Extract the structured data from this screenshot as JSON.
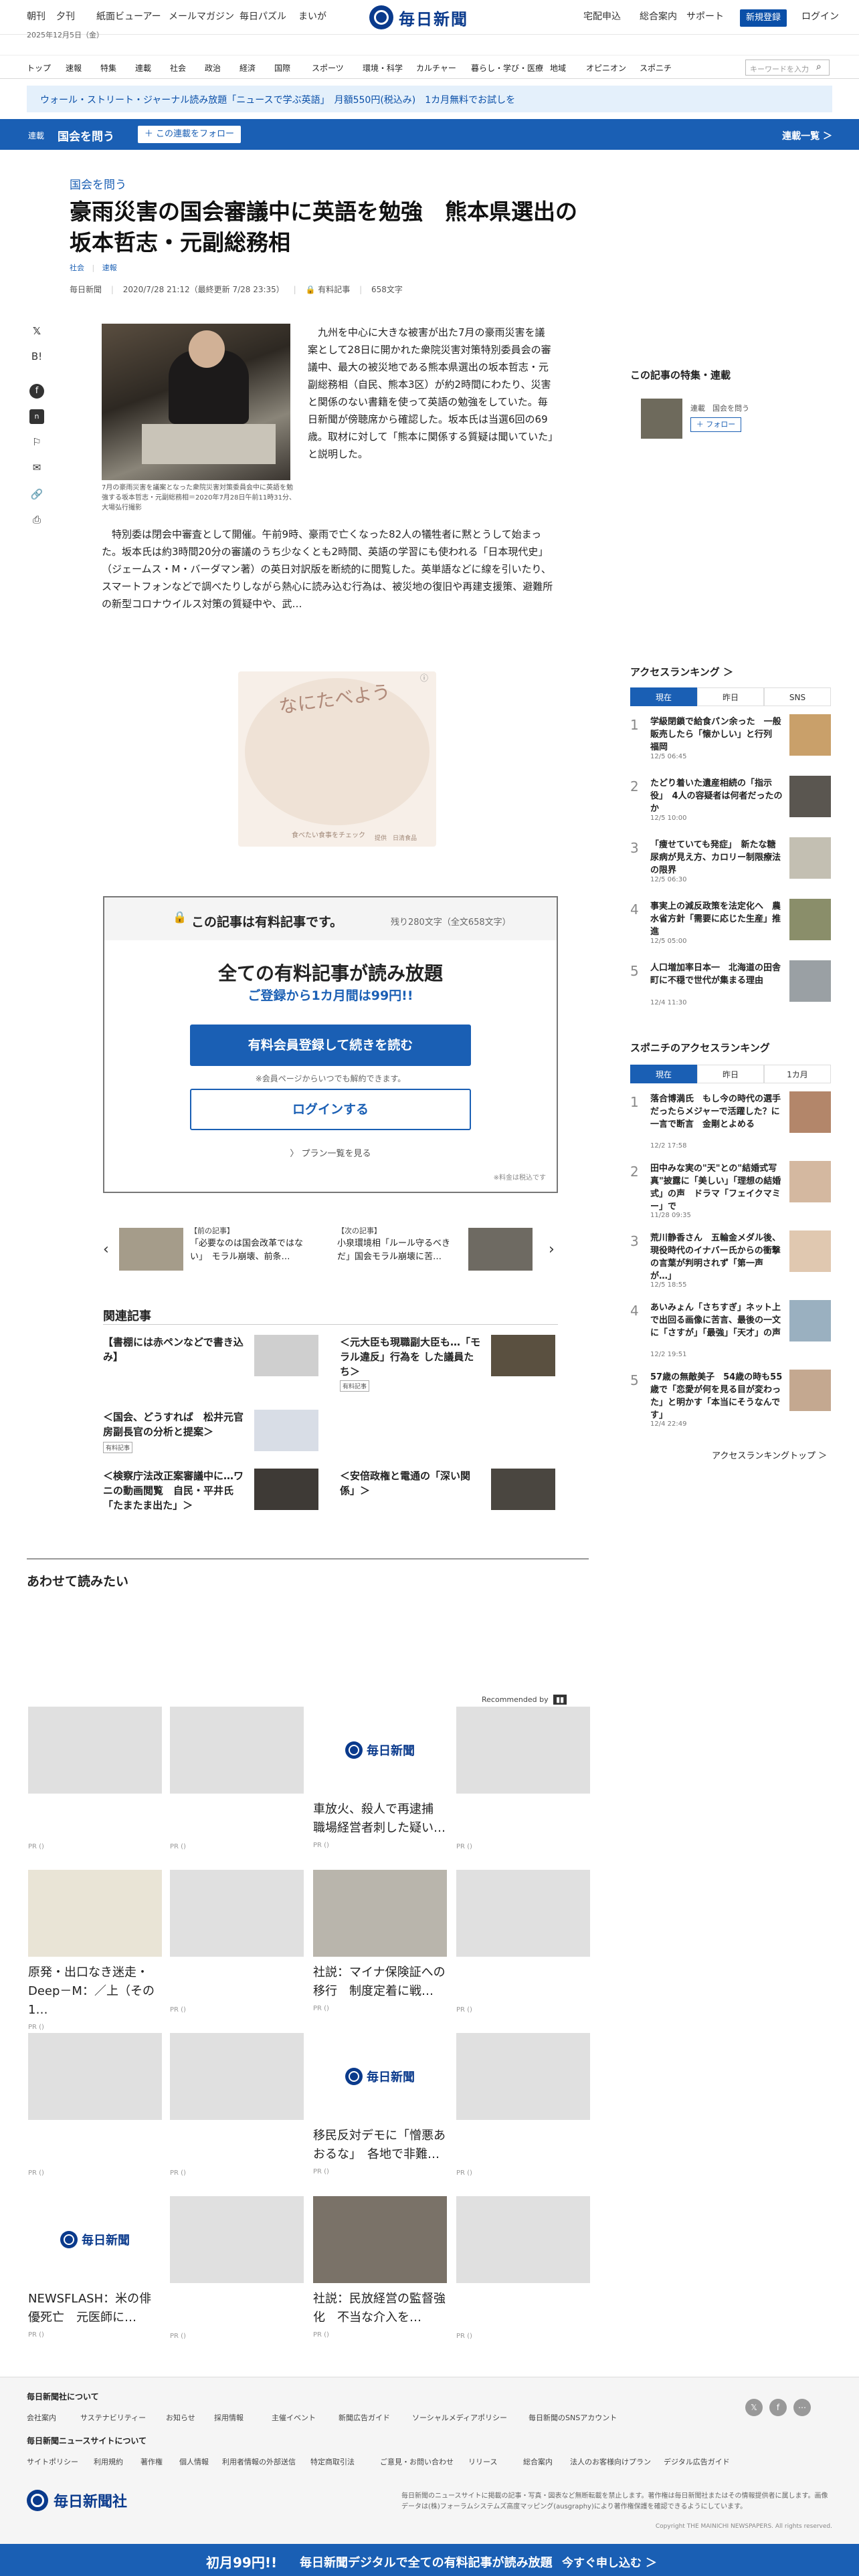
{
  "topbar": {
    "links_left": [
      "朝刊",
      "夕刊",
      "紙面ビューアー",
      "メールマガジン",
      "毎日パズル",
      "まいが"
    ],
    "links_right": [
      "宅配申込",
      "総合案内",
      "サポート"
    ],
    "register": "新規登録",
    "login": "ログイン",
    "logo": "毎日新聞",
    "date": "2025年12月5日（金）"
  },
  "nav": {
    "items": [
      "トップ",
      "速報",
      "特集",
      "連載",
      "社会",
      "政治",
      "経済",
      "国際",
      "スポーツ",
      "環境・科学",
      "カルチャー",
      "暮らし・学び・医療",
      "地域",
      "オピニオン",
      "スポニチ"
    ],
    "search_placeholder": "キーワードを入力"
  },
  "promo": "ウォール・ストリート・ジャーナル読み放題「ニュースで学ぶ英語」　月額550円(税込み)　1カ月無料でお試しを",
  "series": {
    "label": "連載",
    "title": "国会を問う",
    "follow": "＋ この連載をフォロー",
    "all": "連載一覧 ＞"
  },
  "article": {
    "kicker": "国会を問う",
    "headline": "豪雨災害の国会審議中に英語を勉強　熊本県選出の坂本哲志・元副総務相",
    "tags": [
      "社会",
      "速報"
    ],
    "source": "毎日新聞",
    "datetime": "2020/7/28 21:12（最終更新 7/28 23:35）",
    "paid": "有料記事",
    "chars": "658文字",
    "caption": "7月の豪雨災害を議案となった衆院災害対策委員会中に英語を勉強する坂本哲志・元副総務相＝2020年7月28日午前11時31分、大場弘行撮影",
    "lead": "九州を中心に大きな被害が出た7月の豪雨災害を議案として28日に開かれた衆院災害対策特別委員会の審議中、最大の被災地である熊本県選出の坂本哲志・元副総務相（自民、熊本3区）が約2時間にわたり、災害と関係のない書籍を使って英語の勉強をしていた。毎日新聞が傍聴席から確認した。坂本氏は当選6回の69歳。取材に対して「熊本に関係する質疑は聞いていた」と説明した。",
    "body": "特別委は閉会中審査として開催。午前9時、豪雨で亡くなった82人の犠牲者に黙とうして始まった。坂本氏は約3時間20分の審議のうち少なくとも2時間、英語の学習にも使われる「日本現代史」（ジェームス・M・バーダマン著）の英日対訳版を断続的に閲覧した。英単語などに線を引いたり、スマートフォンなどで調べたりしながら熱心に読み込む行為は、被災地の復旧や再建支援策、避難所の新型コロナウイルス対策の質疑中や、武…"
  },
  "ad": {
    "title": "なにたべよう",
    "sub": "食べたい食事をチェック",
    "label": "提供　日清食品"
  },
  "paywall": {
    "head": "この記事は有料記事です。",
    "remain": "残り280文字（全文658文字）",
    "t1": "全ての有料記事が読み放題",
    "t2": "ご登録から1カ月間は99円!!",
    "btn1": "有料会員登録して続きを読む",
    "note": "※会員ページからいつでも解約できます。",
    "btn2": "ログインする",
    "plan": "〉 プラン一覧を見る",
    "tax": "※料金は税込です"
  },
  "prevnext": {
    "prev_label": "【前の記事】",
    "prev_text": "「必要なのは国会改革ではない」　モラル崩壊、前条…",
    "next_label": "【次の記事】",
    "next_text": "小泉環境相「ルール守るべきだ」国会モラル崩壊に苦…"
  },
  "related": {
    "title": "関連記事",
    "items": [
      {
        "text": "【書棚には赤ペンなどで書き込み】",
        "badge": ""
      },
      {
        "text": "＜元大臣も現職副大臣も…「モラル違反」行為を した議員たち＞",
        "badge": "有料記事"
      },
      {
        "text": "＜国会、どうすれば　松井元官房副長官の分析と提案＞",
        "badge": "有料記事"
      },
      {
        "text": "＜検察庁法改正案審議中に…ワニの動画閲覧　自民・平井氏「たまたま出た」＞",
        "badge": ""
      },
      {
        "text": "＜安倍政権と電通の「深い関係」＞",
        "badge": ""
      }
    ]
  },
  "awasete": "あわせて読みたい",
  "recommended_by": "Recommended by",
  "recs": [
    {
      "text": "",
      "logo": false
    },
    {
      "text": "",
      "logo": false
    },
    {
      "text": "車放火、殺人で再逮捕　職場経営者刺した疑い…",
      "logo": true
    },
    {
      "text": "",
      "logo": false
    },
    {
      "text": "原発・出口なき迷走・Deep－M：／上（その1…",
      "logo": false
    },
    {
      "text": "",
      "logo": false
    },
    {
      "text": "社説：マイナ保険証への移行　制度定着に戦…",
      "logo": false
    },
    {
      "text": "",
      "logo": false
    },
    {
      "text": "",
      "logo": false
    },
    {
      "text": "",
      "logo": false
    },
    {
      "text": "移民反対デモに「憎悪あおるな」　各地で非難…",
      "logo": true
    },
    {
      "text": "",
      "logo": false
    },
    {
      "text": "NEWSFLASH：米の俳優死亡　元医師に…",
      "logo": true
    },
    {
      "text": "",
      "logo": false
    },
    {
      "text": "社説：民放経営の監督強化　不当な介入を…",
      "logo": false
    },
    {
      "text": "",
      "logo": false
    }
  ],
  "pr": "PR ()",
  "sidebar": {
    "series_title": "この記事の特集・連載",
    "series_label": "連載　国会を問う",
    "series_follow": "＋ フォロー",
    "ranking_title": "アクセスランキング ＞",
    "tabs": [
      "現在",
      "昨日",
      "SNS"
    ],
    "ranking": [
      {
        "n": "1",
        "t": "学級閉鎖で給食パン余った　一般販売したら「懐かしい」と行列　福岡",
        "d": "12/5 06:45"
      },
      {
        "n": "2",
        "t": "たどり着いた遺産相続の「指示役」　4人の容疑者は何者だったのか",
        "d": "12/5 10:00"
      },
      {
        "n": "3",
        "t": "「痩せていても発症」　新たな糖尿病が見え方、カロリー制限療法の限界",
        "d": "12/5 06:30"
      },
      {
        "n": "4",
        "t": "事実上の減反政策を法定化へ　農水省方針「需要に応じた生産」推進",
        "d": "12/5 05:00"
      },
      {
        "n": "5",
        "t": "人口増加率日本一　北海道の田舎町に不穏で世代が集まる理由",
        "d": "12/4 11:30"
      }
    ],
    "spo_title": "スポニチのアクセスランキング",
    "spo_tabs": [
      "現在",
      "昨日",
      "1カ月"
    ],
    "spo": [
      {
        "n": "1",
        "t": "落合博満氏　もし今の時代の選手だったらメジャーで活躍した？に一言で断言　金剛とよめる",
        "d": "12/2 17:58"
      },
      {
        "n": "2",
        "t": "田中みな実の\"天\"との\"結婚式写真\"披露に「美しい」「理想の結婚式」の声　ドラマ「フェイクマミー」で",
        "d": "11/28 09:35"
      },
      {
        "n": "3",
        "t": "荒川静香さん　五輪金メダル後、現役時代のイナバー氏からの衝撃の言葉が判明されず「第一声が…」",
        "d": "12/5 18:55"
      },
      {
        "n": "4",
        "t": "あいみょん「さちすぎ」ネット上で出回る画像に苦言、最後の一文に「さすが」「最強」「天才」の声",
        "d": "12/2 19:51"
      },
      {
        "n": "5",
        "t": "57歳の無敵美子　54歳の時も55歳で「恋愛が何を見る目が変わった」と明かす「本当にそうなんです」",
        "d": "12/4 22:49"
      }
    ],
    "more": "アクセスランキングトップ ＞"
  },
  "footer": {
    "site_title": "毎日新聞社について",
    "site_links": [
      "会社案内",
      "サステナビリティー",
      "お知らせ",
      "採用情報",
      "主催イベント",
      "新聞広告ガイド",
      "ソーシャルメディアポリシー",
      "毎日新聞のSNSアカウント"
    ],
    "guide_title": "毎日新聞ニュースサイトについて",
    "guide_links": [
      "サイトポリシー",
      "利用規約",
      "著作権",
      "個人情報",
      "利用者情報の外部送信",
      "特定商取引法",
      "ご意見・お問い合わせ",
      "リリース",
      "総合案内",
      "法人のお客様向けプラン",
      "デジタル広告ガイド"
    ],
    "logo": "毎日新聞社",
    "legal": "毎日新聞のニュースサイトに掲載の記事・写真・図表など無断転載を禁止します。著作権は毎日新聞社またはその情報提供者に属します。画像データは(株)フォーラムシステムズ高度マッピング(ausgraphy)により著作権保護を確認できるようにしています。",
    "copy": "Copyright THE MAINICHI NEWSPAPERS. All rights reserved."
  },
  "bottom_bar": {
    "a": "初月99円!!",
    "b": "毎日新聞デジタルで全ての有料記事が読み放題",
    "c": "今すぐ申し込む ＞"
  }
}
